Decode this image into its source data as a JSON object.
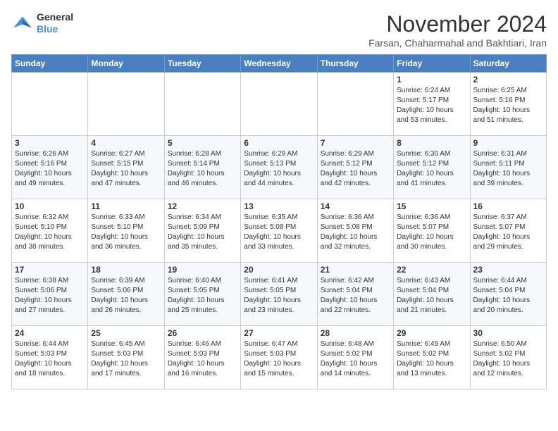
{
  "logo": {
    "line1": "General",
    "line2": "Blue"
  },
  "title": "November 2024",
  "subtitle": "Farsan, Chaharmahal and Bakhtiari, Iran",
  "weekdays": [
    "Sunday",
    "Monday",
    "Tuesday",
    "Wednesday",
    "Thursday",
    "Friday",
    "Saturday"
  ],
  "days": [
    {
      "num": "",
      "info": ""
    },
    {
      "num": "",
      "info": ""
    },
    {
      "num": "",
      "info": ""
    },
    {
      "num": "",
      "info": ""
    },
    {
      "num": "",
      "info": ""
    },
    {
      "num": "1",
      "info": "Sunrise: 6:24 AM\nSunset: 5:17 PM\nDaylight: 10 hours and 53 minutes."
    },
    {
      "num": "2",
      "info": "Sunrise: 6:25 AM\nSunset: 5:16 PM\nDaylight: 10 hours and 51 minutes."
    },
    {
      "num": "3",
      "info": "Sunrise: 6:26 AM\nSunset: 5:16 PM\nDaylight: 10 hours and 49 minutes."
    },
    {
      "num": "4",
      "info": "Sunrise: 6:27 AM\nSunset: 5:15 PM\nDaylight: 10 hours and 47 minutes."
    },
    {
      "num": "5",
      "info": "Sunrise: 6:28 AM\nSunset: 5:14 PM\nDaylight: 10 hours and 46 minutes."
    },
    {
      "num": "6",
      "info": "Sunrise: 6:29 AM\nSunset: 5:13 PM\nDaylight: 10 hours and 44 minutes."
    },
    {
      "num": "7",
      "info": "Sunrise: 6:29 AM\nSunset: 5:12 PM\nDaylight: 10 hours and 42 minutes."
    },
    {
      "num": "8",
      "info": "Sunrise: 6:30 AM\nSunset: 5:12 PM\nDaylight: 10 hours and 41 minutes."
    },
    {
      "num": "9",
      "info": "Sunrise: 6:31 AM\nSunset: 5:11 PM\nDaylight: 10 hours and 39 minutes."
    },
    {
      "num": "10",
      "info": "Sunrise: 6:32 AM\nSunset: 5:10 PM\nDaylight: 10 hours and 38 minutes."
    },
    {
      "num": "11",
      "info": "Sunrise: 6:33 AM\nSunset: 5:10 PM\nDaylight: 10 hours and 36 minutes."
    },
    {
      "num": "12",
      "info": "Sunrise: 6:34 AM\nSunset: 5:09 PM\nDaylight: 10 hours and 35 minutes."
    },
    {
      "num": "13",
      "info": "Sunrise: 6:35 AM\nSunset: 5:08 PM\nDaylight: 10 hours and 33 minutes."
    },
    {
      "num": "14",
      "info": "Sunrise: 6:36 AM\nSunset: 5:08 PM\nDaylight: 10 hours and 32 minutes."
    },
    {
      "num": "15",
      "info": "Sunrise: 6:36 AM\nSunset: 5:07 PM\nDaylight: 10 hours and 30 minutes."
    },
    {
      "num": "16",
      "info": "Sunrise: 6:37 AM\nSunset: 5:07 PM\nDaylight: 10 hours and 29 minutes."
    },
    {
      "num": "17",
      "info": "Sunrise: 6:38 AM\nSunset: 5:06 PM\nDaylight: 10 hours and 27 minutes."
    },
    {
      "num": "18",
      "info": "Sunrise: 6:39 AM\nSunset: 5:06 PM\nDaylight: 10 hours and 26 minutes."
    },
    {
      "num": "19",
      "info": "Sunrise: 6:40 AM\nSunset: 5:05 PM\nDaylight: 10 hours and 25 minutes."
    },
    {
      "num": "20",
      "info": "Sunrise: 6:41 AM\nSunset: 5:05 PM\nDaylight: 10 hours and 23 minutes."
    },
    {
      "num": "21",
      "info": "Sunrise: 6:42 AM\nSunset: 5:04 PM\nDaylight: 10 hours and 22 minutes."
    },
    {
      "num": "22",
      "info": "Sunrise: 6:43 AM\nSunset: 5:04 PM\nDaylight: 10 hours and 21 minutes."
    },
    {
      "num": "23",
      "info": "Sunrise: 6:44 AM\nSunset: 5:04 PM\nDaylight: 10 hours and 20 minutes."
    },
    {
      "num": "24",
      "info": "Sunrise: 6:44 AM\nSunset: 5:03 PM\nDaylight: 10 hours and 18 minutes."
    },
    {
      "num": "25",
      "info": "Sunrise: 6:45 AM\nSunset: 5:03 PM\nDaylight: 10 hours and 17 minutes."
    },
    {
      "num": "26",
      "info": "Sunrise: 6:46 AM\nSunset: 5:03 PM\nDaylight: 10 hours and 16 minutes."
    },
    {
      "num": "27",
      "info": "Sunrise: 6:47 AM\nSunset: 5:03 PM\nDaylight: 10 hours and 15 minutes."
    },
    {
      "num": "28",
      "info": "Sunrise: 6:48 AM\nSunset: 5:02 PM\nDaylight: 10 hours and 14 minutes."
    },
    {
      "num": "29",
      "info": "Sunrise: 6:49 AM\nSunset: 5:02 PM\nDaylight: 10 hours and 13 minutes."
    },
    {
      "num": "30",
      "info": "Sunrise: 6:50 AM\nSunset: 5:02 PM\nDaylight: 10 hours and 12 minutes."
    }
  ]
}
